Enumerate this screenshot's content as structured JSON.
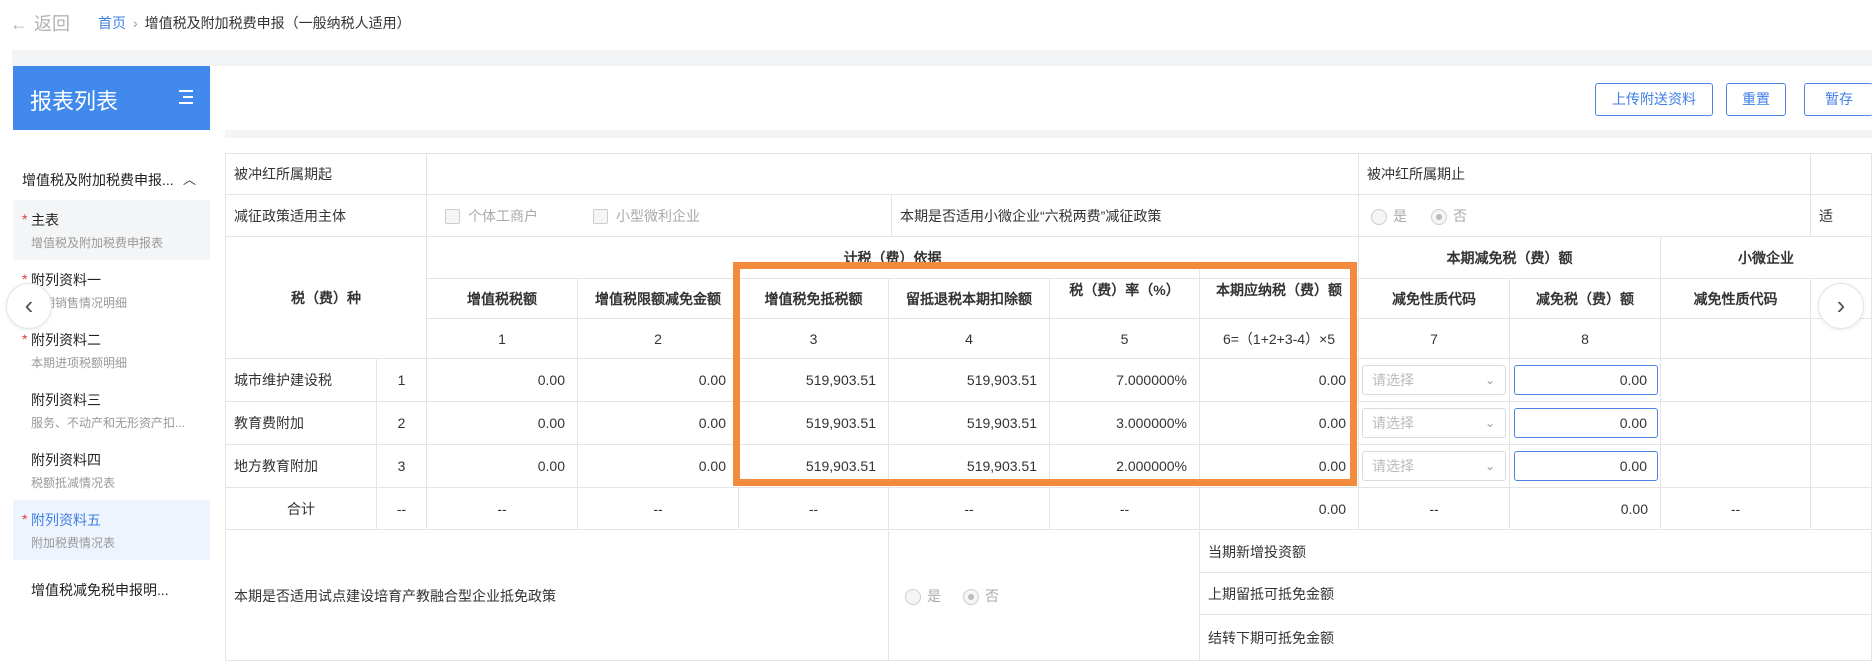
{
  "header": {
    "back_label": "返回",
    "breadcrumb_home": "首页",
    "breadcrumb_current": "增值税及附加税费申报（一般纳税人适用）"
  },
  "sidebar": {
    "title": "报表列表",
    "group_label": "增值税及附加税费申报...",
    "items": [
      {
        "name": "主表",
        "sub": "增值税及附加税费申报表",
        "required": "*"
      },
      {
        "name": "附列资料一",
        "sub": "本期销售情况明细",
        "required": "*"
      },
      {
        "name": "附列资料二",
        "sub": "本期进项税额明细",
        "required": "*"
      },
      {
        "name": "附列资料三",
        "sub": "服务、不动产和无形资产扣..."
      },
      {
        "name": "附列资料四",
        "sub": "税额抵减情况表"
      },
      {
        "name": "附列资料五",
        "sub": "附加税费情况表",
        "required": "*"
      },
      {
        "name": "增值税减免税申报明..."
      }
    ]
  },
  "toolbar": {
    "upload_label": "上传附送资料",
    "reset_label": "重置",
    "save_label": "暂存"
  },
  "form": {
    "row1": {
      "label_start": "被冲红所属期起",
      "label_end": "被冲红所属期止"
    },
    "row2": {
      "label": "减征政策适用主体",
      "opt1": "个体工商户",
      "opt2": "小型微利企业",
      "question": "本期是否适用小微企业“六税两费”减征政策",
      "yes": "是",
      "no": "否",
      "cut": "适"
    }
  },
  "table": {
    "head": {
      "tax_type": "税（费）种",
      "group_basis": "计税（费）依据",
      "col1": "增值税税额",
      "col2": "增值税限额减免金额",
      "col3": "增值税免抵税额",
      "col4": "留抵退税本期扣除额",
      "col5": "税（费）率（%）",
      "col6": "本期应纳税（费）额",
      "group_reduce": "本期减免税（费）额",
      "col7": "减免性质代码",
      "col8": "减免税（费）额",
      "group_small": "小微企业",
      "col9": "减免性质代码",
      "n1": "1",
      "n2": "2",
      "n3": "3",
      "n4": "4",
      "n5": "5",
      "n6": "6=（1+2+3-4）×5",
      "n7": "7",
      "n8": "8"
    },
    "rows": [
      {
        "name": "城市维护建设税",
        "no": "1",
        "c1": "0.00",
        "c2": "0.00",
        "c3": "519,903.51",
        "c4": "519,903.51",
        "c5": "7.000000%",
        "c6": "0.00",
        "c7": "请选择",
        "c8": "0.00"
      },
      {
        "name": "教育费附加",
        "no": "2",
        "c1": "0.00",
        "c2": "0.00",
        "c3": "519,903.51",
        "c4": "519,903.51",
        "c5": "3.000000%",
        "c6": "0.00",
        "c7": "请选择",
        "c8": "0.00"
      },
      {
        "name": "地方教育附加",
        "no": "3",
        "c1": "0.00",
        "c2": "0.00",
        "c3": "519,903.51",
        "c4": "519,903.51",
        "c5": "2.000000%",
        "c6": "0.00",
        "c7": "请选择",
        "c8": "0.00"
      }
    ],
    "total": {
      "name": "合计",
      "no": "--",
      "c1": "--",
      "c2": "--",
      "c3": "--",
      "c4": "--",
      "c5": "--",
      "c6": "0.00",
      "c7": "--",
      "c8": "0.00",
      "c9": "--"
    },
    "bottom": {
      "policy": "本期是否适用试点建设培育产教融合型企业抵免政策",
      "yes": "是",
      "no": "否",
      "r1": "当期新增投资额",
      "r2": "上期留抵可抵免金额",
      "r3": "结转下期可抵免金额"
    }
  },
  "icons": {
    "back": "arrow-left-icon",
    "menu": "menu-collapse-icon",
    "prev": "chevron-left-icon",
    "next": "chevron-right-icon"
  },
  "colors": {
    "accent": "#4189ed",
    "highlight": "#f38a3c",
    "required": "#e03b3b"
  }
}
